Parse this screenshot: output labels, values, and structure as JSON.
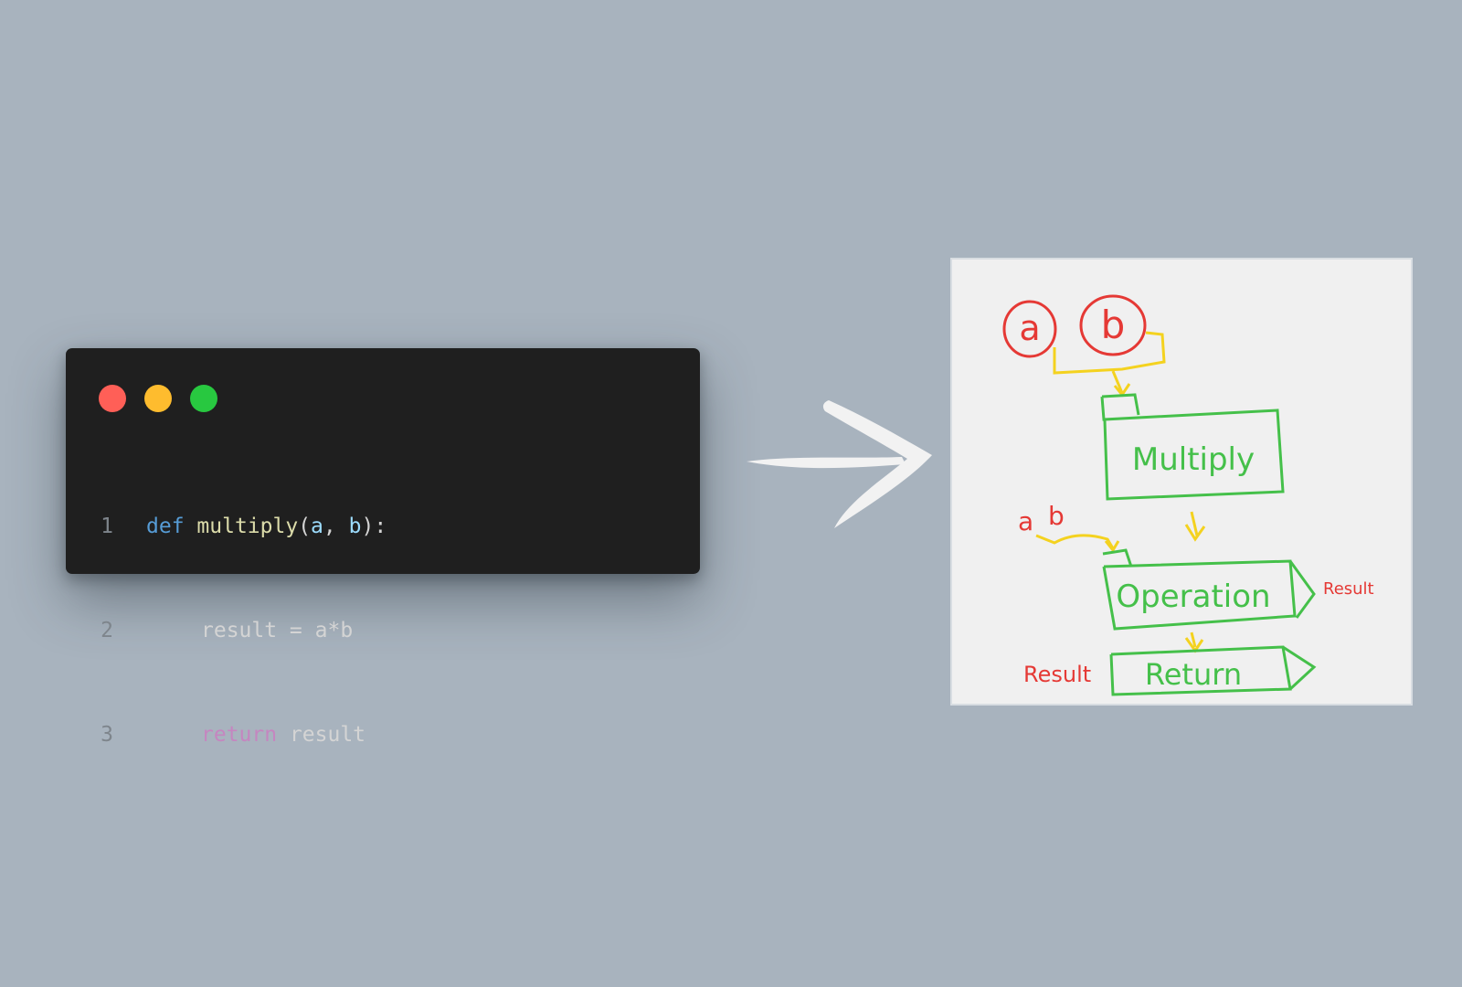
{
  "code": {
    "lines": [
      {
        "number": "1",
        "tokens": [
          {
            "text": "def",
            "kind": "keyword"
          },
          {
            "text": " ",
            "kind": "plain"
          },
          {
            "text": "multiply",
            "kind": "func"
          },
          {
            "text": "(",
            "kind": "punct"
          },
          {
            "text": "a",
            "kind": "param"
          },
          {
            "text": ", ",
            "kind": "punct"
          },
          {
            "text": "b",
            "kind": "param"
          },
          {
            "text": "):",
            "kind": "punct"
          }
        ]
      },
      {
        "number": "2",
        "tokens": [
          {
            "text": "result = a*b",
            "kind": "plain"
          }
        ]
      },
      {
        "number": "3",
        "tokens": [
          {
            "text": "return",
            "kind": "ret"
          },
          {
            "text": " result",
            "kind": "plain"
          }
        ]
      }
    ]
  },
  "window_controls": {
    "close_color": "#ff5f57",
    "minimize_color": "#febc2e",
    "maximize_color": "#28c840"
  },
  "diagram": {
    "input_a": "a",
    "input_b": "b",
    "multiply_label": "Multiply",
    "small_a": "a",
    "small_b": "b",
    "operation_label": "Operation",
    "operation_output": "Result",
    "return_input": "Result",
    "return_label": "Return",
    "colors": {
      "red": "#e53935",
      "yellow": "#f4d21f",
      "green": "#45c04a",
      "board": "#f0f0f0"
    }
  }
}
